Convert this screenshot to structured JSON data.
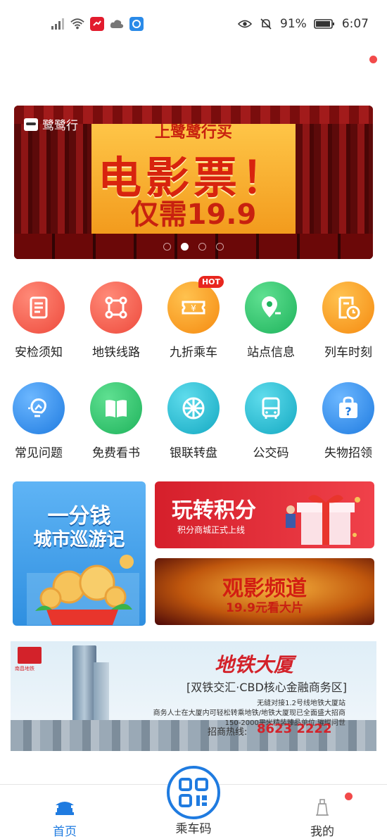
{
  "status_bar": {
    "battery": "91%",
    "time": "6:07"
  },
  "banner": {
    "brand": "鹭鹭行",
    "line1": "上鹭鹭行买",
    "line2": "电影票！",
    "line3": "仅需19.9",
    "page_count": 4,
    "active_page": 2
  },
  "grid_row1": [
    {
      "label": "安检须知",
      "icon": "checklist-icon",
      "color": "#f2574c"
    },
    {
      "label": "地铁线路",
      "icon": "route-icon",
      "color": "#f2574c"
    },
    {
      "label": "九折乘车",
      "icon": "ticket-icon",
      "color": "#f69a1c",
      "badge": "HOT"
    },
    {
      "label": "站点信息",
      "icon": "location-pin-icon",
      "color": "#2fbf6a"
    },
    {
      "label": "列车时刻",
      "icon": "schedule-icon",
      "color": "#f69a1c"
    }
  ],
  "grid_row2": [
    {
      "label": "常见问题",
      "icon": "lightbulb-icon",
      "color": "#2a8ae8"
    },
    {
      "label": "免费看书",
      "icon": "book-icon",
      "color": "#2fbf6a"
    },
    {
      "label": "银联转盘",
      "icon": "wheel-icon",
      "color": "#1fb0c6"
    },
    {
      "label": "公交码",
      "icon": "bus-icon",
      "color": "#1fb0c6"
    },
    {
      "label": "失物招领",
      "icon": "lost-bag-icon",
      "color": "#2a8ae8"
    }
  ],
  "promo_left": {
    "line1": "一分钱",
    "line2": "城市巡游记"
  },
  "promo_points": {
    "title": "玩转积分",
    "subtitle": "积分商城正式上线"
  },
  "promo_movie": {
    "title": "观影频道",
    "subtitle": "19.9元看大片"
  },
  "ad": {
    "logo_text": "南昌地铁",
    "title": "地铁大厦",
    "subtitle": "[双铁交汇·CBD核心金融商务区]",
    "line1": "无缝对接1.2号线地铁大厦站",
    "line2": "商务人士在大厦内可轻松转乘地铁/地铁大厦现已全面盛大招商",
    "line3": "150-2000平米精装臻品单位 璀璨问世",
    "hotline_label": "招商热线:",
    "hotline": "8623 2222"
  },
  "tabbar": {
    "home": "首页",
    "qr": "乘车码",
    "mine": "我的"
  },
  "colors": {
    "accent": "#1f7be0",
    "badge_red": "#f24a4a"
  }
}
